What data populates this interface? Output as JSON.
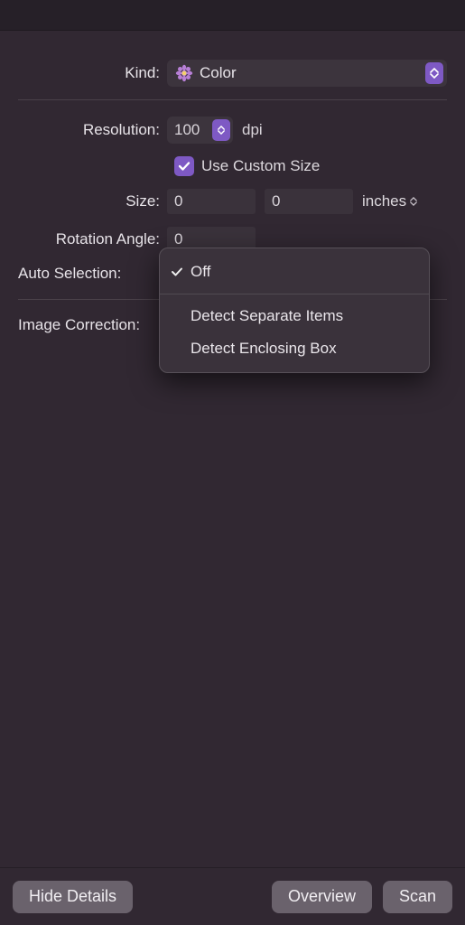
{
  "form": {
    "kind": {
      "label": "Kind:",
      "value": "Color"
    },
    "resolution": {
      "label": "Resolution:",
      "value": "100",
      "unit": "dpi"
    },
    "use_custom_size": {
      "label": "Use Custom Size",
      "checked": true
    },
    "size": {
      "label": "Size:",
      "width": "0",
      "height": "0",
      "unit": "inches"
    },
    "rotation": {
      "label": "Rotation Angle:",
      "value": "0"
    },
    "auto_selection": {
      "label": "Auto Selection:"
    },
    "image_correction": {
      "label": "Image Correction:"
    }
  },
  "popup": {
    "items": [
      {
        "label": "Off",
        "checked": true
      },
      {
        "label": "Detect Separate Items",
        "checked": false
      },
      {
        "label": "Detect Enclosing Box",
        "checked": false
      }
    ]
  },
  "footer": {
    "hide_details": "Hide Details",
    "overview": "Overview",
    "scan": "Scan"
  }
}
